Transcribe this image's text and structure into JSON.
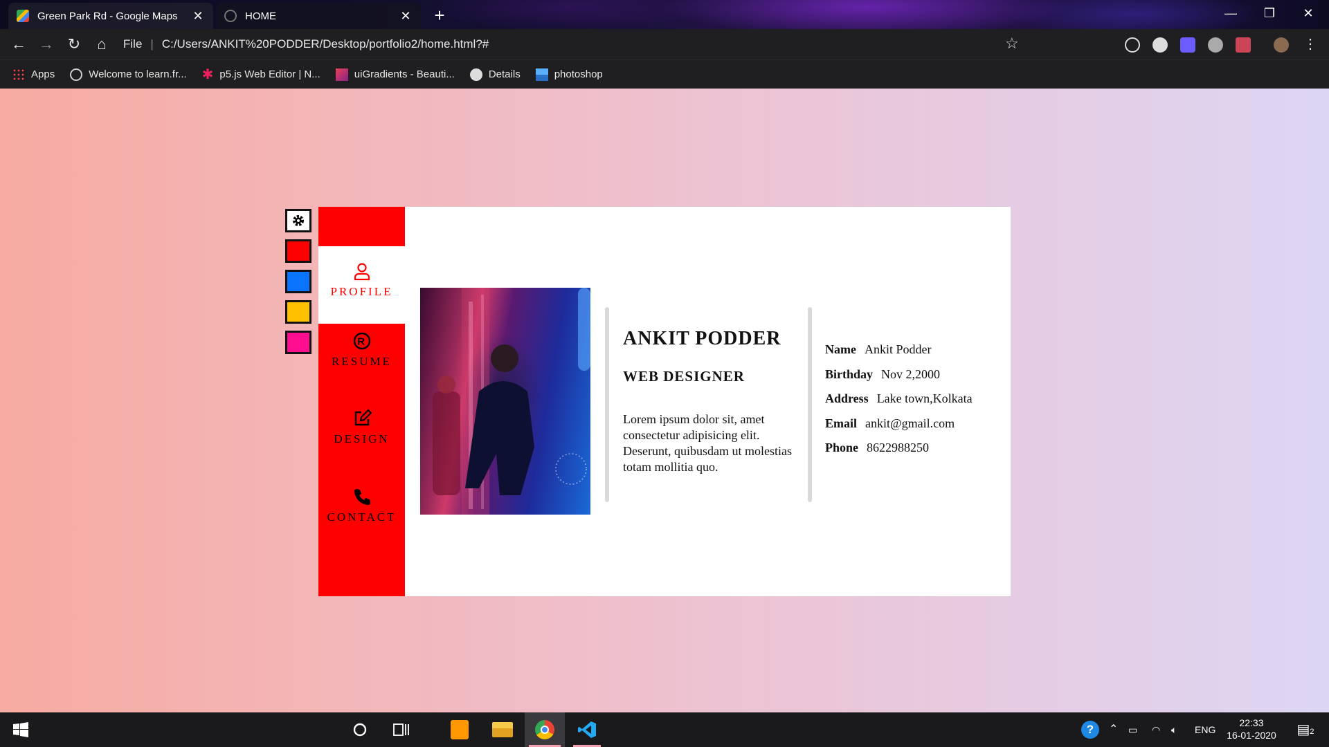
{
  "browser": {
    "tabs": [
      {
        "title": "Green Park Rd - Google Maps",
        "active": false
      },
      {
        "title": "HOME",
        "active": true
      }
    ],
    "address": {
      "scheme_label": "File",
      "url": "C:/Users/ANKIT%20PODDER/Desktop/portfolio2/home.html?#"
    },
    "bookmarks": [
      {
        "label": "Apps",
        "icon": "apps-grid-icon"
      },
      {
        "label": "Welcome to learn.fr...",
        "icon": "freecodecamp-icon"
      },
      {
        "label": "p5.js Web Editor | N...",
        "icon": "p5js-icon"
      },
      {
        "label": "uiGradients - Beauti...",
        "icon": "uigradients-icon"
      },
      {
        "label": "Details",
        "icon": "globe-icon"
      },
      {
        "label": "photoshop",
        "icon": "image-icon"
      }
    ]
  },
  "portfolio": {
    "theme_colors": {
      "red": "#ff0000",
      "blue": "#0a74ff",
      "yellow": "#ffc000",
      "pink": "#ff0f8f"
    },
    "nav": [
      {
        "label": "PROFILE",
        "icon": "user-icon",
        "active": true
      },
      {
        "label": "RESUME",
        "icon": "registered-icon",
        "active": false
      },
      {
        "label": "DESIGN",
        "icon": "edit-icon",
        "active": false
      },
      {
        "label": "CONTACT",
        "icon": "phone-icon",
        "active": false
      }
    ],
    "name": "ANKIT PODDER",
    "role": "WEB DESIGNER",
    "description": "Lorem ipsum dolor sit, amet consectetur adipisicing elit. Deserunt, quibusdam ut molestias totam mollitia quo.",
    "details": [
      {
        "key": "Name",
        "value": "Ankit Podder"
      },
      {
        "key": "Birthday",
        "value": "Nov 2,2000"
      },
      {
        "key": "Address",
        "value": "Lake town,Kolkata"
      },
      {
        "key": "Email",
        "value": "ankit@gmail.com"
      },
      {
        "key": "Phone",
        "value": "8622988250"
      }
    ]
  },
  "taskbar": {
    "apps": [
      "windows-start-icon",
      "cortana-icon",
      "task-view-icon",
      "sublime-text-icon",
      "file-explorer-icon",
      "chrome-icon",
      "vscode-icon"
    ],
    "language": "ENG",
    "time": "22:33",
    "date": "16-01-2020",
    "notifications": "2"
  }
}
